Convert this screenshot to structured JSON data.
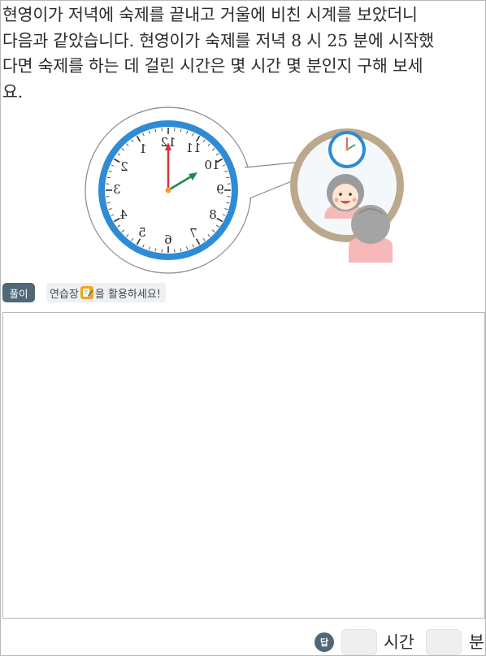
{
  "question": {
    "lines": [
      "현영이가 저녁에 숙제를 끝내고 거울에 비친 시계를 보았더니",
      "다음과 같았습니다. 현영이가 숙제를 저녁 8 시 25 분에 시작했",
      "다면 숙제를 하는 데 걸린 시간은 몇 시간 몇 분인지 구해 보세",
      "요."
    ]
  },
  "clock": {
    "numerals": [
      "12",
      "1",
      "2",
      "3",
      "4",
      "5",
      "6",
      "7",
      "8",
      "9",
      "10",
      "11"
    ],
    "rim_color": "#2e8bd6",
    "hour_hand_color": "#1f8a4c",
    "minute_hand_color": "#d8323a"
  },
  "solution": {
    "badge": "풀이",
    "tip_before": "연습장",
    "tip_after": "을 활용하세요!"
  },
  "answer": {
    "badge": "답",
    "hours_value": "",
    "hours_unit": "시간",
    "minutes_value": "",
    "minutes_unit": "분"
  }
}
